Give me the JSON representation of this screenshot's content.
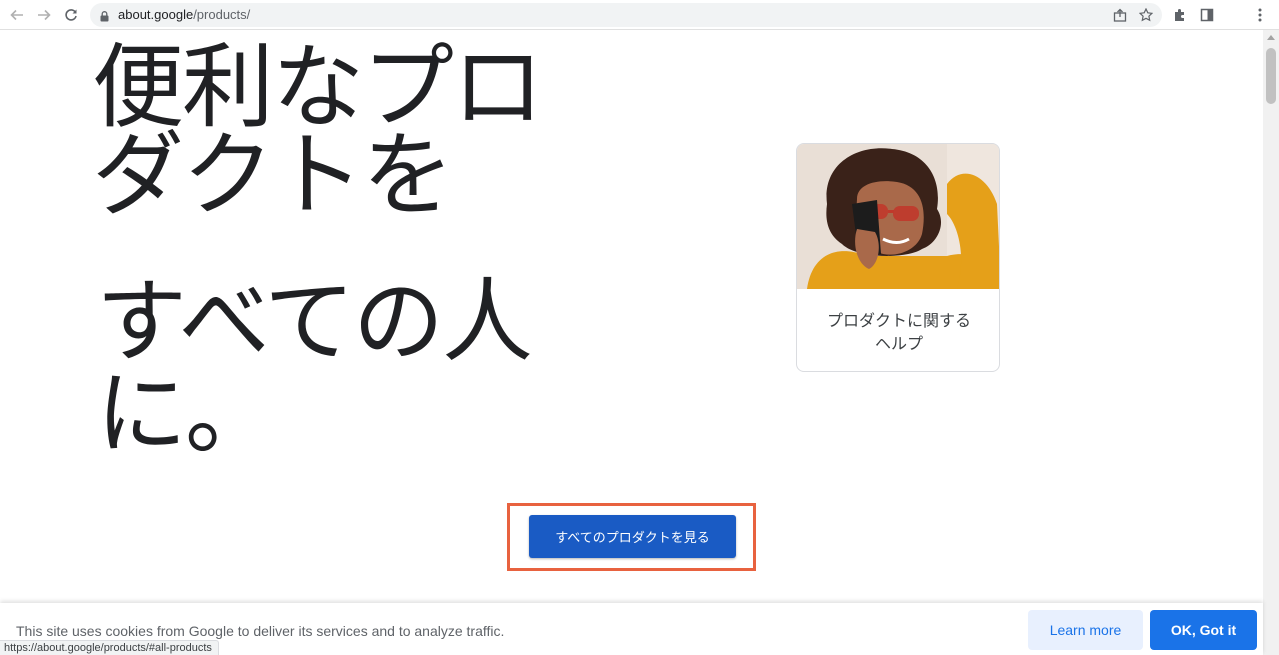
{
  "browser": {
    "url_domain": "about.google",
    "url_path": "/products/",
    "icons": [
      "back-icon",
      "forward-icon",
      "reload-icon",
      "lock-icon",
      "share-icon",
      "star-icon",
      "extensions-icon",
      "side-panel-icon",
      "menu-icon"
    ]
  },
  "hero": {
    "line1": "便利なプロ",
    "line2": "ダクトを",
    "line3": "すべての人",
    "line4": "に。"
  },
  "card": {
    "label_line1": "プロダクトに関する",
    "label_line2": "ヘルプ"
  },
  "cta": {
    "label": "すべてのプロダクトを見る",
    "highlight_color": "#e8623f",
    "color": "#1a5bc4"
  },
  "cookie": {
    "text": "This site uses cookies from Google to deliver its services and to analyze traffic.",
    "learn_more": "Learn more",
    "ok": "OK, Got it"
  },
  "status": {
    "hover_url": "https://about.google/products/#all-products"
  }
}
